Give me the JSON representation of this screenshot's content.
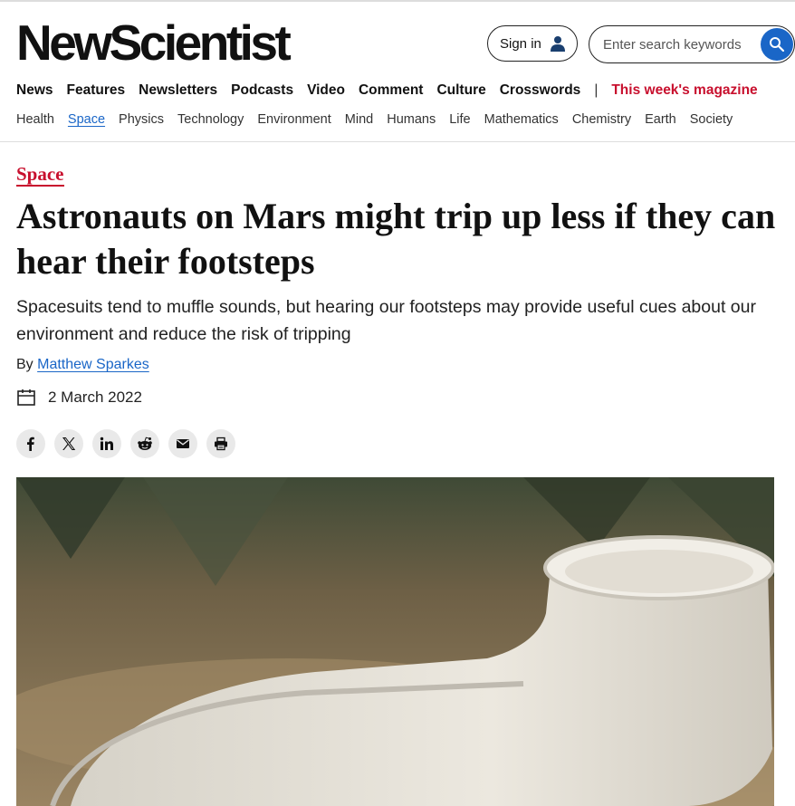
{
  "header": {
    "logo": "NewScientist",
    "signin_label": "Sign in",
    "search_placeholder": "Enter search keywords"
  },
  "main_nav": {
    "items": [
      "News",
      "Features",
      "Newsletters",
      "Podcasts",
      "Video",
      "Comment",
      "Culture",
      "Crosswords"
    ],
    "separator": "|",
    "magazine_label": "This week's magazine"
  },
  "sub_nav": {
    "items": [
      "Health",
      "Space",
      "Physics",
      "Technology",
      "Environment",
      "Mind",
      "Humans",
      "Life",
      "Mathematics",
      "Chemistry",
      "Earth",
      "Society"
    ],
    "active": "Space"
  },
  "article": {
    "section": "Space",
    "headline": "Astronauts on Mars might trip up less if they can hear their footsteps",
    "standfirst": "Spacesuits tend to muffle sounds, but hearing our footsteps may provide useful cues about our environment and reduce the risk of tripping",
    "byline_prefix": "By",
    "author": "Matthew Sparkes",
    "date": "2 March 2022"
  },
  "share_icons": [
    "facebook-icon",
    "x-icon",
    "linkedin-icon",
    "reddit-icon",
    "email-icon",
    "print-icon"
  ],
  "colors": {
    "accent_red": "#c8102e",
    "link_blue": "#1a66c7",
    "share_bg": "#e9e9e9"
  }
}
